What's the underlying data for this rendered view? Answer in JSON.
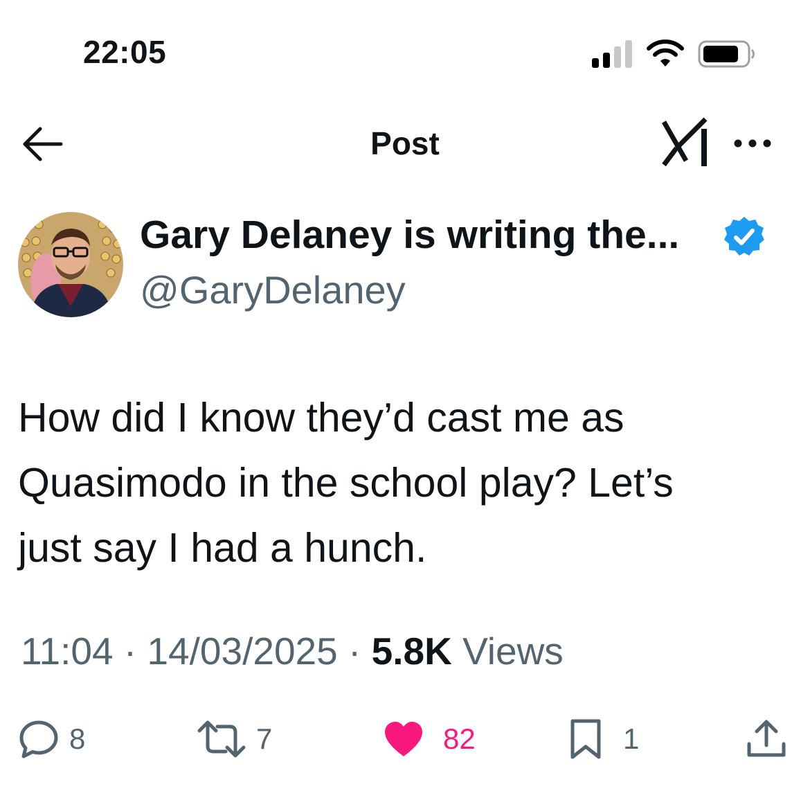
{
  "status_bar": {
    "time": "22:05",
    "icons": [
      "cellular-signal-icon",
      "wifi-icon",
      "battery-icon"
    ]
  },
  "header": {
    "title": "Post",
    "back_icon": "arrow-left-icon",
    "grok_icon": "grok-icon",
    "more_icon": "more-horizontal-icon"
  },
  "author": {
    "display_name": "Gary Delaney is writing the...",
    "handle": "@GaryDelaney",
    "verified_icon": "verified-badge-icon"
  },
  "post": {
    "lines": [
      "How did I know they’d cast me as",
      "Quasimodo in the school play? Let’s",
      "just say I had a hunch."
    ]
  },
  "meta": {
    "time": "11:04",
    "separator": "·",
    "date": "14/03/2025",
    "views_count": "5.8K",
    "views_label": "Views"
  },
  "actions": {
    "replies": "8",
    "reposts": "7",
    "likes": "82",
    "bookmarks": "1"
  },
  "colors": {
    "text": "#0f1419",
    "secondary": "#536471",
    "like": "#f91880",
    "verified": "#1d9bf0"
  }
}
